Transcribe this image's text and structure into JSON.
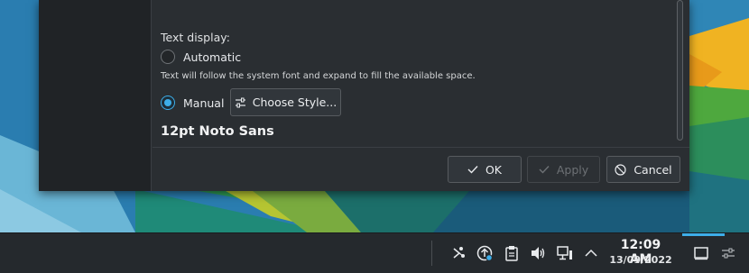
{
  "dialog": {
    "section_label": "Text display:",
    "options": [
      {
        "label": "Automatic",
        "checked": false
      },
      {
        "label": "Manual",
        "checked": true
      }
    ],
    "automatic_hint": "Text will follow the system font and expand to fill the available space.",
    "choose_style_label": "Choose Style...",
    "font_summary": "12pt Noto Sans",
    "buttons": {
      "ok": "OK",
      "apply": "Apply",
      "cancel": "Cancel"
    }
  },
  "taskbar": {
    "tray_icons": [
      "kde-connect-icon",
      "updates-icon",
      "clipboard-icon",
      "volume-icon",
      "network-icon",
      "chevron-up-icon"
    ],
    "clock_time": "12:09 AM",
    "clock_date": "13/09/2022",
    "show_desktop_icon": "show-desktop-icon",
    "panel_settings_icon": "panel-settings-icon"
  },
  "colors": {
    "accent": "#3daee9",
    "dialog_bg": "#2a2e32",
    "panel_bg": "#25292d"
  }
}
